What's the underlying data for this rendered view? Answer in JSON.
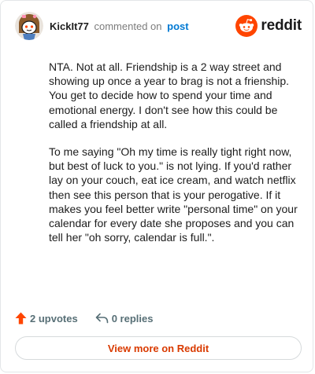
{
  "header": {
    "username": "KickIt77",
    "verb": "commented on",
    "post_link": "post",
    "brand_name": "reddit",
    "avatar_icon": "snoo-avatar-icon",
    "brand_icon": "reddit-snoo-icon"
  },
  "comment": {
    "paragraphs": [
      "NTA. Not at all. Friendship is a 2 way street and showing up once a year to brag is not a frienship. You get to decide how to spend your time and emotional energy. I don't see how this could be called a friendship at all.",
      "To me saying \"Oh my time is really tight right now, but best of luck to you.\" is not lying. If you'd rather lay on your couch, eat ice cream, and watch netflix then see this person that is your perogative. If it makes you feel better write \"personal time\" on your calendar for every date she proposes and you can tell her \"oh sorry, calendar is full.\"."
    ]
  },
  "actions": {
    "upvotes": "2 upvotes",
    "replies": "0 replies",
    "upvote_icon": "upvote-arrow-icon",
    "reply_icon": "reply-arrow-icon"
  },
  "footer": {
    "view_more": "View more on Reddit"
  },
  "colors": {
    "brand_orange": "#ff4500",
    "link_blue": "#0079d3",
    "view_more_text": "#d93a00",
    "muted": "#576f76"
  }
}
